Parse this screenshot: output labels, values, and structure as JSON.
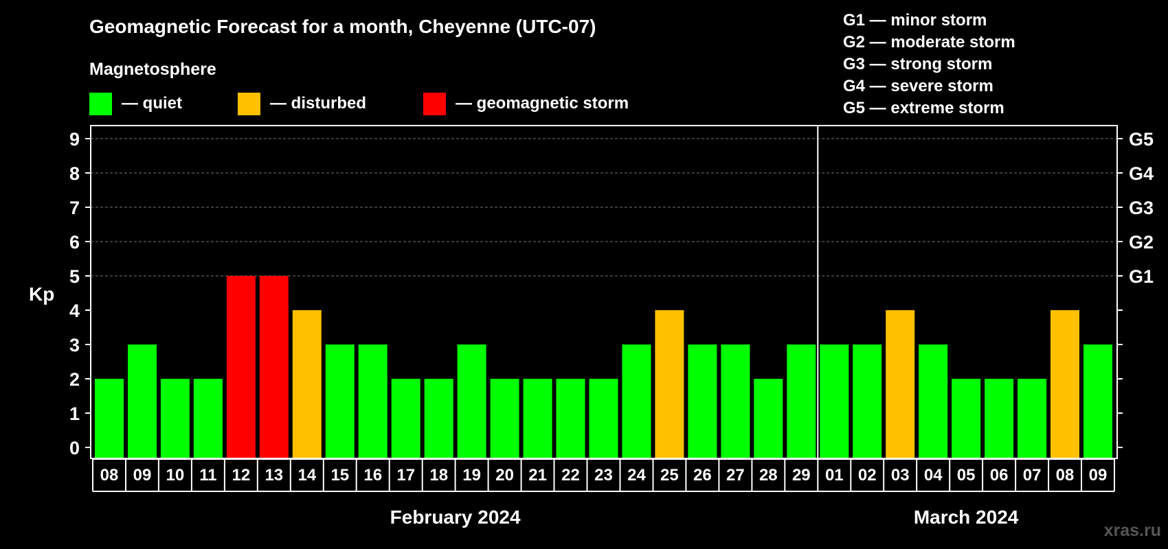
{
  "chart_data": {
    "type": "bar",
    "title": "Geomagnetic Forecast for a month, Cheyenne (UTC-07)",
    "ylabel": "Kp",
    "ylim": [
      0,
      9
    ],
    "yticks": [
      "0",
      "1",
      "2",
      "3",
      "4",
      "5",
      "6",
      "7",
      "8",
      "9"
    ],
    "right_axis_labels": [
      {
        "kp": 5,
        "label": "G1"
      },
      {
        "kp": 6,
        "label": "G2"
      },
      {
        "kp": 7,
        "label": "G3"
      },
      {
        "kp": 8,
        "label": "G4"
      },
      {
        "kp": 9,
        "label": "G5"
      }
    ],
    "categories": [
      "08",
      "09",
      "10",
      "11",
      "12",
      "13",
      "14",
      "15",
      "16",
      "17",
      "18",
      "19",
      "20",
      "21",
      "22",
      "23",
      "24",
      "25",
      "26",
      "27",
      "28",
      "29",
      "01",
      "02",
      "03",
      "04",
      "05",
      "06",
      "07",
      "08",
      "09"
    ],
    "values": [
      2,
      3,
      2,
      2,
      5,
      5,
      4,
      3,
      3,
      2,
      2,
      3,
      2,
      2,
      2,
      2,
      3,
      4,
      3,
      3,
      2,
      3,
      3,
      3,
      4,
      3,
      2,
      2,
      2,
      4,
      3
    ],
    "months": [
      {
        "label": "February 2024",
        "start_index": 0,
        "count": 22
      },
      {
        "label": "March 2024",
        "start_index": 22,
        "count": 9
      }
    ],
    "color_key": {
      "quiet": "#00ff00",
      "disturbed": "#ffc000",
      "storm": "#ff0000"
    },
    "grid": true,
    "legend": {
      "heading": "Magnetosphere",
      "items": [
        {
          "key": "quiet",
          "label": "— quiet",
          "color": "#00ff00"
        },
        {
          "key": "disturbed",
          "label": "— disturbed",
          "color": "#ffc000"
        },
        {
          "key": "storm",
          "label": "— geomagnetic storm",
          "color": "#ff0000"
        }
      ]
    },
    "storm_scale": [
      "G1 — minor storm",
      "G2 — moderate storm",
      "G3 — strong storm",
      "G4 — severe storm",
      "G5 — extreme storm"
    ],
    "watermark": "xras.ru"
  }
}
